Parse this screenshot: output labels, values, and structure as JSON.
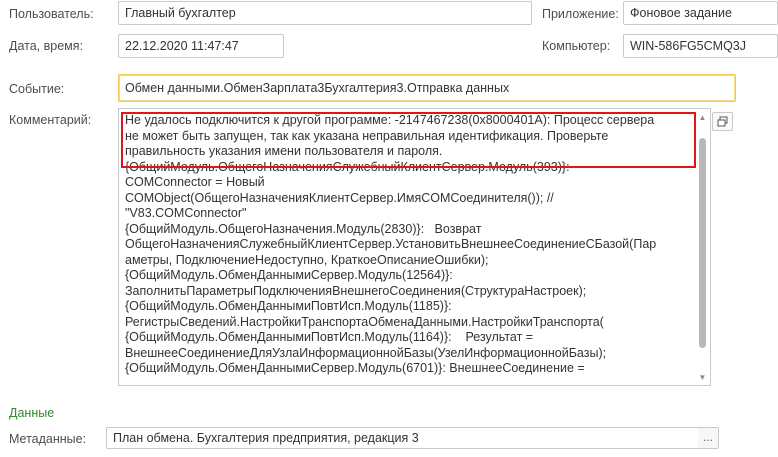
{
  "user": {
    "label": "Пользователь:",
    "value": "Главный бухгалтер"
  },
  "app": {
    "label": "Приложение:",
    "value": "Фоновое задание"
  },
  "datetime": {
    "label": "Дата, время:",
    "value": "22.12.2020 11:47:47"
  },
  "computer": {
    "label": "Компьютер:",
    "value": "WIN-586FG5CMQ3J"
  },
  "event": {
    "label": "Событие:",
    "value": "Обмен данными.ОбменЗарплата3Бухгалтерия3.Отправка данных"
  },
  "comment": {
    "label": "Комментарий:",
    "text": "Не удалось подключится к другой программе: -2147467238(0x8000401A): Процесс сервера\nне может быть запущен, так как указана неправильная идентификация. Проверьте\nправильность указания имени пользователя и пароля.\n{ОбщийМодуль.ОбщегоНазначенияСлужебныйКлиентСервер.Модуль(393)}:\nCOMConnector = Новый\nCOMObject(ОбщегоНазначенияКлиентСервер.ИмяCOMСоединителя()); //\n\"V83.COMConnector\"\n{ОбщийМодуль.ОбщегоНазначения.Модуль(2830)}:   Возврат\nОбщегоНазначенияСлужебныйКлиентСервер.УстановитьВнешнееСоединениеСБазой(Пар\nаметры, ПодключениеНедоступно, КраткоеОписаниеОшибки);\n{ОбщийМодуль.ОбменДаннымиСервер.Модуль(12564)}:\nЗаполнитьПараметрыПодключенияВнешнегоСоединения(СтруктураНастроек);\n{ОбщийМодуль.ОбменДаннымиПовтИсп.Модуль(1185)}:\nРегистрыСведений.НастройкиТранспортаОбменаДанными.НастройкиТранспорта(\n{ОбщийМодуль.ОбменДаннымиПовтИсп.Модуль(1164)}:    Результат =\nВнешнееСоединениеДляУзлаИнформационнойБазы(УзелИнформационнойБазы);\n{ОбщийМодуль.ОбменДаннымиСервер.Модуль(6701)}: ВнешнееСоединение ="
  },
  "data_section": {
    "title": "Данные"
  },
  "metadata": {
    "label": "Метаданные:",
    "value": "План обмена. Бухгалтерия предприятия, редакция 3",
    "button": "..."
  },
  "colors": {
    "highlight": "#e0141a",
    "section_title": "#2e8b2e",
    "focus": "#f2c84b"
  }
}
